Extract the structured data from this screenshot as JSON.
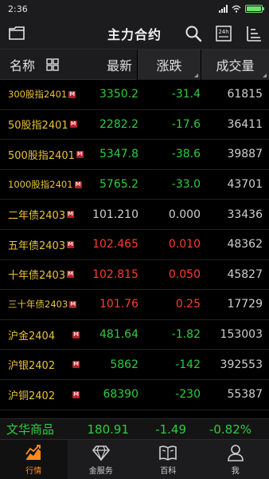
{
  "status": {
    "time": "2:36"
  },
  "header": {
    "title": "主力合约"
  },
  "columns": {
    "name": "名称",
    "latest": "最新",
    "change": "涨跌",
    "volume": "成交量"
  },
  "rows": [
    {
      "name": "300股指2401",
      "badge": "M",
      "latest": "3350.2",
      "change": "-31.4",
      "volume": "61815",
      "dir": "down"
    },
    {
      "name": "50股指2401",
      "badge": "M",
      "latest": "2282.2",
      "change": "-17.6",
      "volume": "36411",
      "dir": "down"
    },
    {
      "name": "500股指2401",
      "badge": "M",
      "latest": "5347.8",
      "change": "-38.6",
      "volume": "39887",
      "dir": "down"
    },
    {
      "name": "1000股指2401",
      "badge": "M",
      "latest": "5765.2",
      "change": "-33.0",
      "volume": "43701",
      "dir": "down"
    },
    {
      "name": "二年债2403",
      "badge": "M",
      "latest": "101.210",
      "change": "0.000",
      "volume": "33436",
      "dir": "flat"
    },
    {
      "name": "五年债2403",
      "badge": "M",
      "latest": "102.465",
      "change": "0.010",
      "volume": "48362",
      "dir": "up"
    },
    {
      "name": "十年债2403",
      "badge": "M",
      "latest": "102.815",
      "change": "0.050",
      "volume": "45827",
      "dir": "up"
    },
    {
      "name": "三十年债2403",
      "badge": "M",
      "latest": "101.76",
      "change": "0.25",
      "volume": "17729",
      "dir": "up"
    },
    {
      "name": "沪金2404",
      "badge": "M",
      "latest": "481.64",
      "change": "-1.82",
      "volume": "153003",
      "dir": "down"
    },
    {
      "name": "沪银2402",
      "badge": "M",
      "latest": "5862",
      "change": "-142",
      "volume": "392553",
      "dir": "down"
    },
    {
      "name": "沪铜2402",
      "badge": "M",
      "latest": "68390",
      "change": "-230",
      "volume": "55387",
      "dir": "down"
    }
  ],
  "ticker": {
    "name": "文华商品",
    "value": "180.91",
    "change": "-1.49",
    "percent": "-0.82%"
  },
  "tabs": [
    {
      "label": "行情",
      "icon": "chart-icon"
    },
    {
      "label": "金服务",
      "icon": "diamond-icon"
    },
    {
      "label": "百科",
      "icon": "book-icon"
    },
    {
      "label": "我",
      "icon": "person-icon"
    }
  ],
  "colors": {
    "up": "#ff3b30",
    "down": "#2ecc40",
    "name": "#e8c23a",
    "accent": "#ff8a1f"
  }
}
